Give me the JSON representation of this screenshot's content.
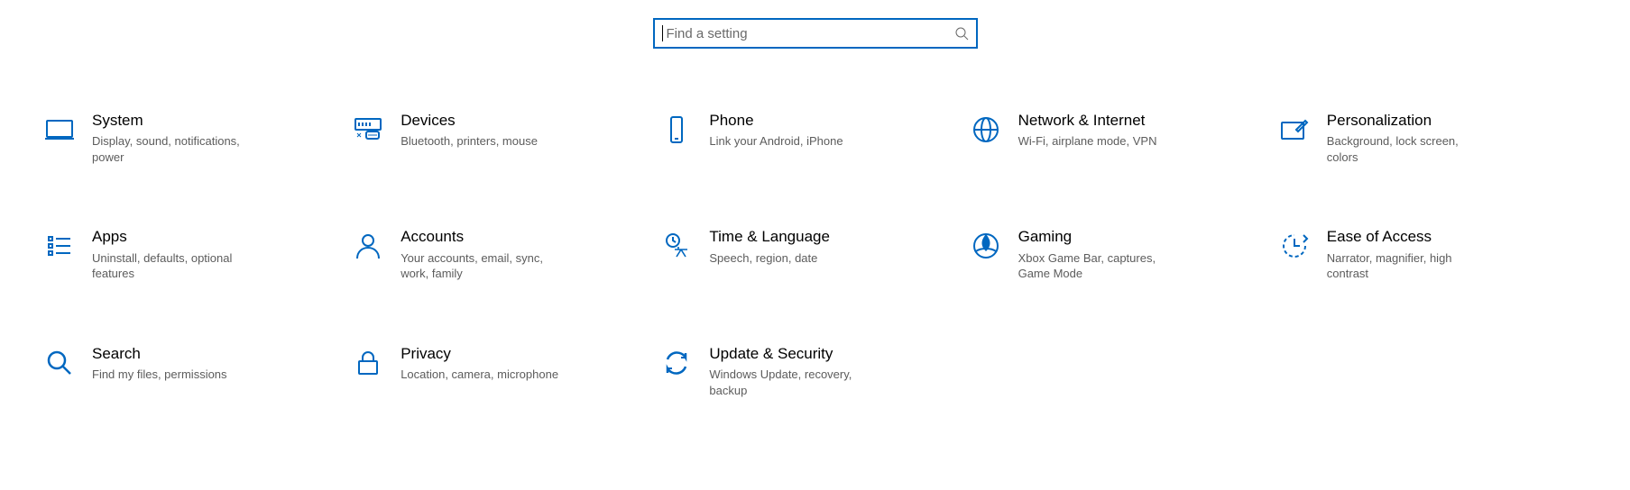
{
  "search": {
    "placeholder": "Find a setting"
  },
  "tiles": {
    "system": {
      "title": "System",
      "desc": "Display, sound, notifications, power"
    },
    "devices": {
      "title": "Devices",
      "desc": "Bluetooth, printers, mouse"
    },
    "phone": {
      "title": "Phone",
      "desc": "Link your Android, iPhone"
    },
    "network": {
      "title": "Network & Internet",
      "desc": "Wi-Fi, airplane mode, VPN"
    },
    "personalization": {
      "title": "Personalization",
      "desc": "Background, lock screen, colors"
    },
    "apps": {
      "title": "Apps",
      "desc": "Uninstall, defaults, optional features"
    },
    "accounts": {
      "title": "Accounts",
      "desc": "Your accounts, email, sync, work, family"
    },
    "time": {
      "title": "Time & Language",
      "desc": "Speech, region, date"
    },
    "gaming": {
      "title": "Gaming",
      "desc": "Xbox Game Bar, captures, Game Mode"
    },
    "ease": {
      "title": "Ease of Access",
      "desc": "Narrator, magnifier, high contrast"
    },
    "search": {
      "title": "Search",
      "desc": "Find my files, permissions"
    },
    "privacy": {
      "title": "Privacy",
      "desc": "Location, camera, microphone"
    },
    "update": {
      "title": "Update & Security",
      "desc": "Windows Update, recovery, backup"
    }
  }
}
